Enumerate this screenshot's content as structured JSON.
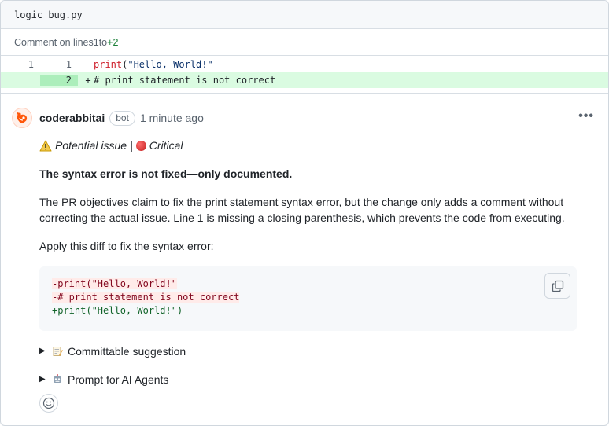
{
  "file": {
    "name": "logic_bug.py"
  },
  "comment_on": {
    "prefix": "Comment on lines ",
    "start": "1",
    "to": " to ",
    "range": "+2"
  },
  "diff": {
    "rows": [
      {
        "old": "1",
        "new": "1",
        "marker": "",
        "fn": "print",
        "open": "(",
        "str": "\"Hello, World!\""
      },
      {
        "old": "",
        "new": "2",
        "marker": "+",
        "comment": "# print statement is not correct"
      }
    ]
  },
  "comment": {
    "author": "coderabbitai",
    "badge": "bot",
    "timestamp": "1 minute ago",
    "issue_label": "Potential issue",
    "separator": "|",
    "severity": "Critical",
    "heading": "The syntax error is not fixed—only documented.",
    "paragraph": "The PR objectives claim to fix the print statement syntax error, but the change only adds a comment without correcting the actual issue. Line 1 is missing a closing parenthesis, which prevents the code from executing.",
    "apply_text": "Apply this diff to fix the syntax error:",
    "code_lines": {
      "del1": "-print(\"Hello, World!\"",
      "del2": "-# print statement is not correct",
      "add1": "+print(\"Hello, World!\")"
    },
    "details": [
      {
        "label": "Committable suggestion",
        "icon": "memo-icon"
      },
      {
        "label": "Prompt for AI Agents",
        "icon": "robot-icon"
      }
    ]
  },
  "colors": {
    "added_bg": "#dafbe1",
    "added_gutter": "#aceebb",
    "deletion_text": "#82071e",
    "addition_text": "#116329",
    "accent_green": "#1a7f37"
  }
}
